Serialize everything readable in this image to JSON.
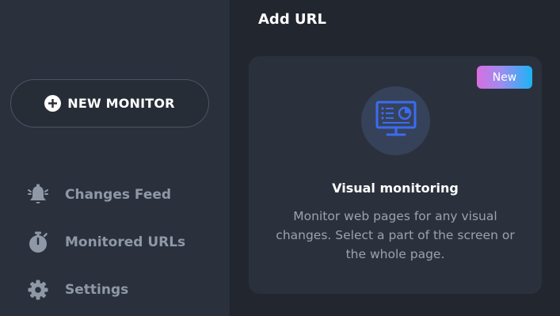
{
  "sidebar": {
    "new_monitor_label": "NEW MONITOR",
    "items": [
      {
        "label": "Changes Feed",
        "icon": "bell-icon"
      },
      {
        "label": "Monitored URLs",
        "icon": "stopwatch-icon"
      },
      {
        "label": "Settings",
        "icon": "gear-icon"
      }
    ]
  },
  "main": {
    "title": "Add URL",
    "card": {
      "badge": "New",
      "icon": "monitor-chart-icon",
      "title": "Visual monitoring",
      "description": "Monitor web pages for any visual changes. Select a part of the screen or the whole page."
    }
  },
  "colors": {
    "background": "#22272f",
    "sidebar": "#2a313c",
    "card": "#2b313c",
    "accent_blue": "#3b6cf0",
    "muted_text": "#8f98a6"
  }
}
